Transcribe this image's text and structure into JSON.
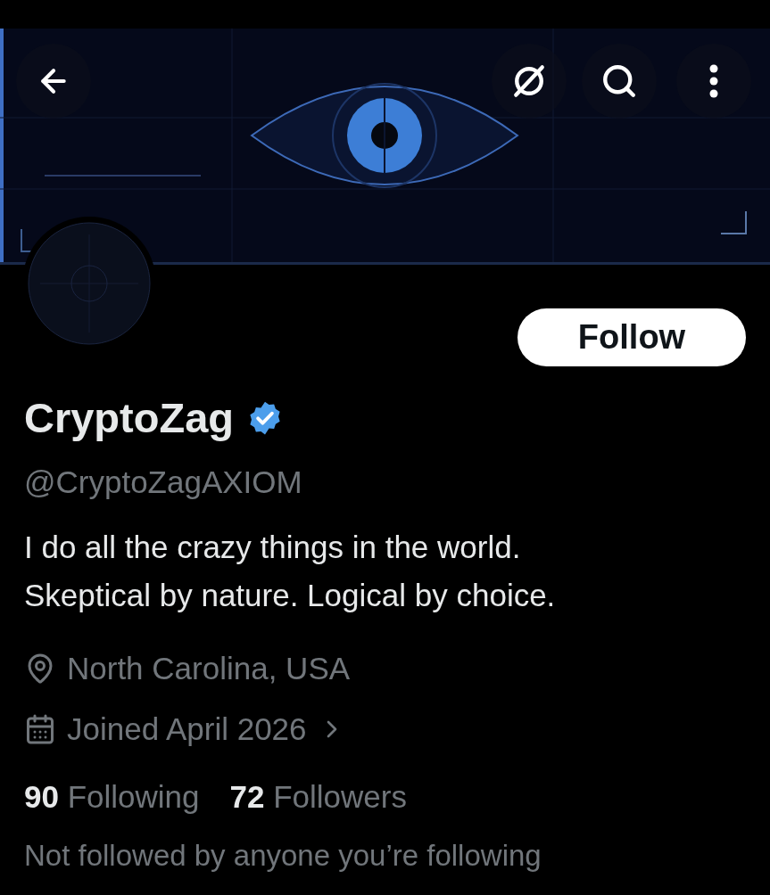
{
  "follow_button": {
    "label": "Follow"
  },
  "profile": {
    "name": "CryptoZag",
    "verified": true,
    "handle": "@CryptoZagAXIOM",
    "bio": [
      "I do all the crazy things in the world.",
      "Skeptical by nature. Logical by choice."
    ],
    "location": "North Carolina, USA",
    "joined": "Joined April 2026",
    "following_count": "90",
    "following_label": "Following",
    "followers_count": "72",
    "followers_label": "Followers"
  },
  "mutuals_note": "Not followed by anyone you’re following"
}
